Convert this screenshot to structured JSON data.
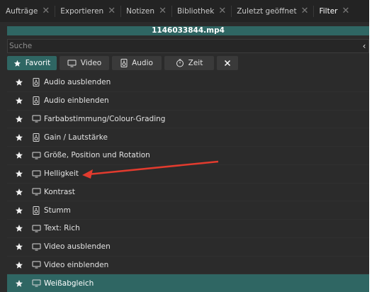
{
  "tabs": [
    {
      "label": "Aufträge",
      "active": false
    },
    {
      "label": "Exportieren",
      "active": false
    },
    {
      "label": "Notizen",
      "active": false
    },
    {
      "label": "Bibliothek",
      "active": false
    },
    {
      "label": "Zuletzt geöffnet",
      "active": false
    },
    {
      "label": "Filter",
      "active": true
    }
  ],
  "file": {
    "title": "1146033844.mp4"
  },
  "search": {
    "placeholder": "Suche",
    "value": ""
  },
  "filter_buttons": {
    "favorit": "Favorit",
    "video": "Video",
    "audio": "Audio",
    "zeit": "Zeit"
  },
  "filters": [
    {
      "label": "Audio ausblenden",
      "type": "audio-icon"
    },
    {
      "label": "Audio einblenden",
      "type": "audio-icon"
    },
    {
      "label": "Farbabstimmung/Colour-Grading",
      "type": "monitor-icon"
    },
    {
      "label": "Gain / Lautstärke",
      "type": "audio-icon"
    },
    {
      "label": "Größe, Position und Rotation",
      "type": "monitor-icon"
    },
    {
      "label": "Helligkeit",
      "type": "monitor-icon"
    },
    {
      "label": "Kontrast",
      "type": "monitor-icon"
    },
    {
      "label": "Stumm",
      "type": "audio-icon"
    },
    {
      "label": "Text: Rich",
      "type": "monitor-icon"
    },
    {
      "label": "Video ausblenden",
      "type": "monitor-icon"
    },
    {
      "label": "Video einblenden",
      "type": "monitor-icon"
    },
    {
      "label": "Weißabgleich",
      "type": "monitor-icon",
      "selected": true
    }
  ],
  "colors": {
    "accent": "#2f6663",
    "background": "#2b2b2b",
    "annotation_arrow": "#e23b2e"
  }
}
